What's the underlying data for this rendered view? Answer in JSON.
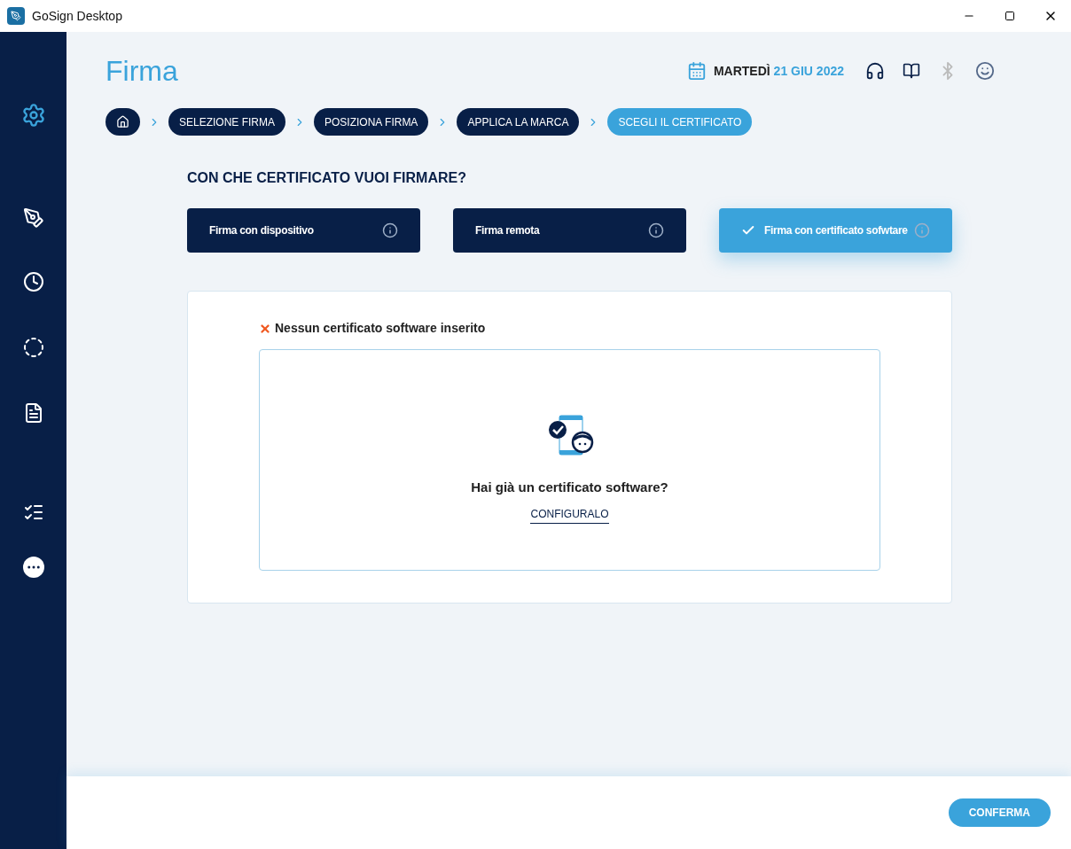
{
  "window": {
    "title": "GoSign Desktop"
  },
  "page_title": "Firma",
  "date": {
    "weekday": "MARTEDÌ",
    "date": "21 GIU 2022"
  },
  "breadcrumb": [
    {
      "label": "SELEZIONE FIRMA",
      "selected": false
    },
    {
      "label": "POSIZIONA FIRMA",
      "selected": false
    },
    {
      "label": "APPLICA LA MARCA",
      "selected": false
    },
    {
      "label": "SCEGLI IL CERTIFICATO",
      "selected": true
    }
  ],
  "question": "CON CHE CERTIFICATO VUOI FIRMARE?",
  "options": [
    {
      "label": "Firma con dispositivo",
      "selected": false
    },
    {
      "label": "Firma remota",
      "selected": false
    },
    {
      "label": "Firma con certificato sofwtare",
      "selected": true
    }
  ],
  "status": "Nessun certificato software inserito",
  "prompt": "Hai già un certificato software?",
  "link": "CONFIGURALO",
  "confirm_button": "CONFERMA"
}
